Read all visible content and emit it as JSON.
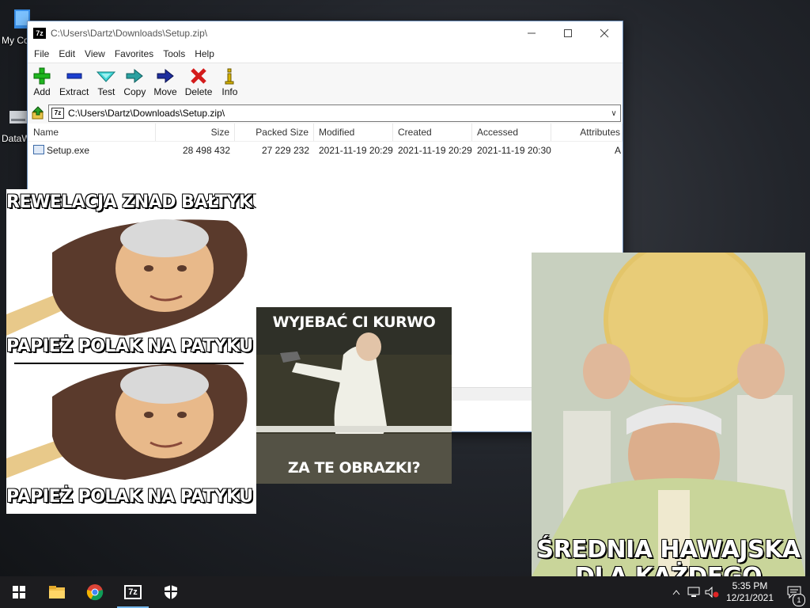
{
  "desktop": {
    "icons": [
      {
        "label": "My Co"
      },
      {
        "label": "DataW"
      }
    ]
  },
  "window": {
    "title": "C:\\Users\\Dartz\\Downloads\\Setup.zip\\",
    "app_icon_text": "7z",
    "menu": [
      "File",
      "Edit",
      "View",
      "Favorites",
      "Tools",
      "Help"
    ],
    "toolbar": [
      {
        "label": "Add",
        "icon": "plus-icon"
      },
      {
        "label": "Extract",
        "icon": "minus-icon"
      },
      {
        "label": "Test",
        "icon": "check-icon"
      },
      {
        "label": "Copy",
        "icon": "copy-arrow-icon"
      },
      {
        "label": "Move",
        "icon": "move-arrow-icon"
      },
      {
        "label": "Delete",
        "icon": "delete-x-icon"
      },
      {
        "label": "Info",
        "icon": "info-icon"
      }
    ],
    "address": "C:\\Users\\Dartz\\Downloads\\Setup.zip\\",
    "columns": [
      "Name",
      "Size",
      "Packed Size",
      "Modified",
      "Created",
      "Accessed",
      "Attributes"
    ],
    "files": [
      {
        "name": "Setup.exe",
        "size": "28 498 432",
        "packed": "27 229 232",
        "modified": "2021-11-19 20:29",
        "created": "2021-11-19 20:29",
        "accessed": "2021-11-19 20:30",
        "attributes": "A"
      }
    ]
  },
  "memes": {
    "left_top_text": "REWELACJA ZNAD BAŁTYKU",
    "left_mid_text": "PAPIEŻ POLAK NA PATYKU XD",
    "left_bottom_text": "PAPIEŻ POLAK NA PATYKU XD",
    "center_top_text": "WYJEBAĆ CI KURWO",
    "center_bottom_text": "ZA TE OBRAZKI?",
    "right_bottom_line1": "ŚREDNIA HAWAJSKA",
    "right_bottom_line2": "DLA KAŻDEGO"
  },
  "taskbar": {
    "items": [
      {
        "name": "start-button",
        "icon": "windows-logo-icon"
      },
      {
        "name": "file-explorer",
        "icon": "folder-icon"
      },
      {
        "name": "chrome",
        "icon": "chrome-icon"
      },
      {
        "name": "7zip",
        "icon": "7zip-icon",
        "text": "7z"
      },
      {
        "name": "security",
        "icon": "shield-icon"
      }
    ],
    "time": "5:35 PM",
    "date": "12/21/2021",
    "notification_count": "1"
  },
  "colors": {
    "taskbar_bg": "#1c1c1f",
    "accent": "#76b9ed",
    "window_border": "#6b8db8"
  }
}
